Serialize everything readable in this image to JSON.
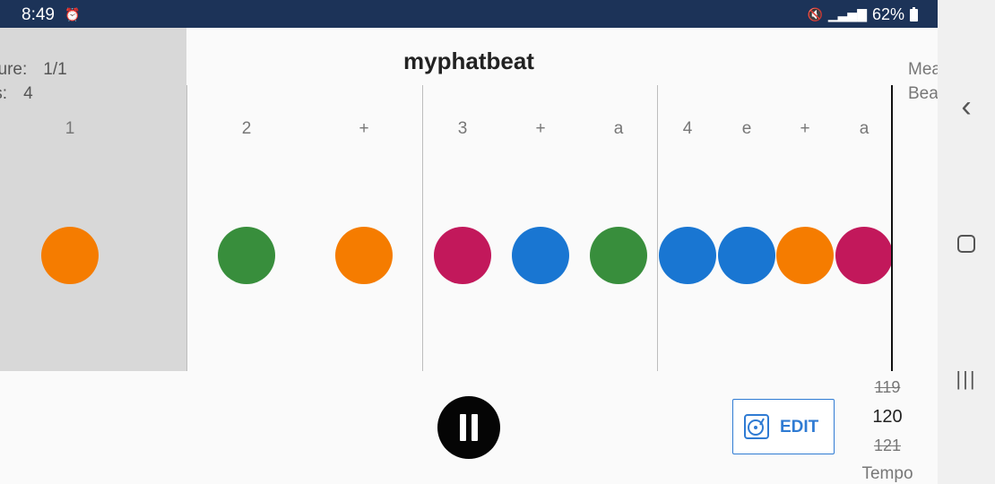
{
  "status": {
    "time": "8:49",
    "battery": "62%",
    "alarm_icon": "alarm-icon",
    "mute_icon": "mute-icon",
    "signal_icon": "signal-icon"
  },
  "title": "myphatbeat",
  "left_info": {
    "measure_label": "sure:",
    "measure_value": "1/1",
    "beats_label": "ts:",
    "beats_value": "4"
  },
  "right_info": {
    "measure_label": "Mea",
    "beats_label": "Bea"
  },
  "beat_labels": [
    "1",
    "2",
    "+",
    "3",
    "+",
    "a",
    "4",
    "e",
    "+",
    "a"
  ],
  "notes": [
    {
      "color": "#f57c00"
    },
    {
      "color": "#388e3c"
    },
    {
      "color": "#f57c00"
    },
    {
      "color": "#c2185b"
    },
    {
      "color": "#1976d2"
    },
    {
      "color": "#388e3c"
    },
    {
      "color": "#1976d2"
    },
    {
      "color": "#1976d2"
    },
    {
      "color": "#f57c00"
    },
    {
      "color": "#c2185b"
    }
  ],
  "controls": {
    "pause_icon": "pause-icon",
    "edit_label": "EDIT",
    "edit_icon": "turntable-icon"
  },
  "tempo": {
    "prev": "119",
    "current": "120",
    "next": "121",
    "label": "Tempo"
  },
  "nav": {
    "back_icon": "back-icon",
    "home_icon": "home-icon",
    "recent_icon": "recent-apps-icon"
  }
}
